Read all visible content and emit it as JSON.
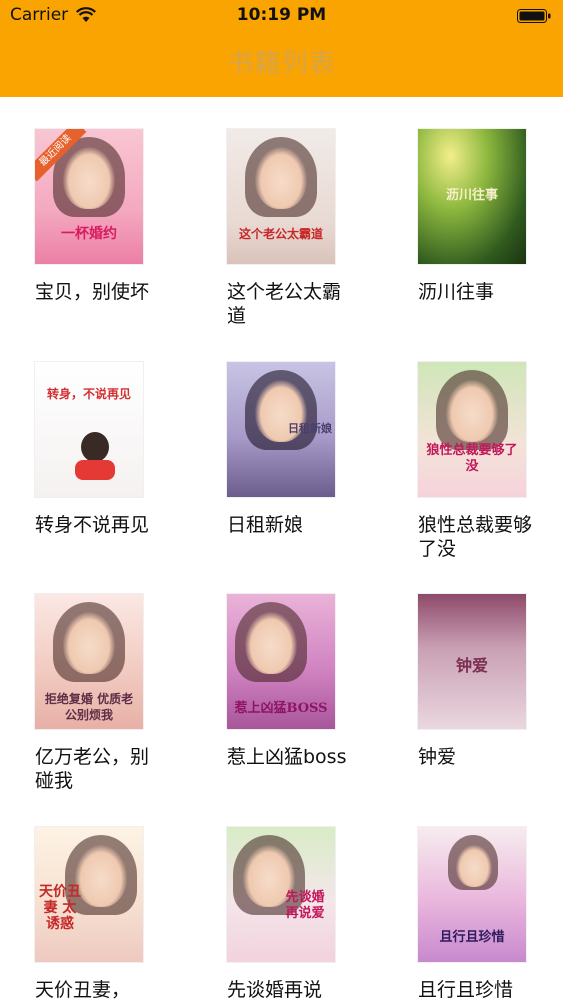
{
  "status_bar": {
    "carrier": "Carrier",
    "time": "10:19 PM"
  },
  "nav": {
    "title": "书籍列表"
  },
  "books": [
    {
      "title": "宝贝，别使坏",
      "cover_text": "一杯婚约",
      "badge": "最近阅读"
    },
    {
      "title": "这个老公太霸道",
      "cover_text": "这个老公太霸道"
    },
    {
      "title": "沥川往事",
      "cover_text": "沥川往事"
    },
    {
      "title": "转身不说再见",
      "cover_text": "转身，不说再见"
    },
    {
      "title": "日租新娘",
      "cover_text": "日租新娘"
    },
    {
      "title": "狼性总裁要够了没",
      "cover_text": "狼性总裁要够了没"
    },
    {
      "title": "亿万老公，别碰我",
      "cover_text": "拒绝复婚 优质老公别烦我"
    },
    {
      "title": "惹上凶猛boss",
      "cover_text": "惹上凶猛BOSS"
    },
    {
      "title": "钟爱",
      "cover_text": "钟爱"
    },
    {
      "title": "天价丑妻，",
      "cover_text": "天价丑妻 太诱惑"
    },
    {
      "title": "先谈婚再说",
      "cover_text": "先谈婚 再说爱"
    },
    {
      "title": "且行且珍惜",
      "cover_text": "且行且珍惜"
    }
  ]
}
